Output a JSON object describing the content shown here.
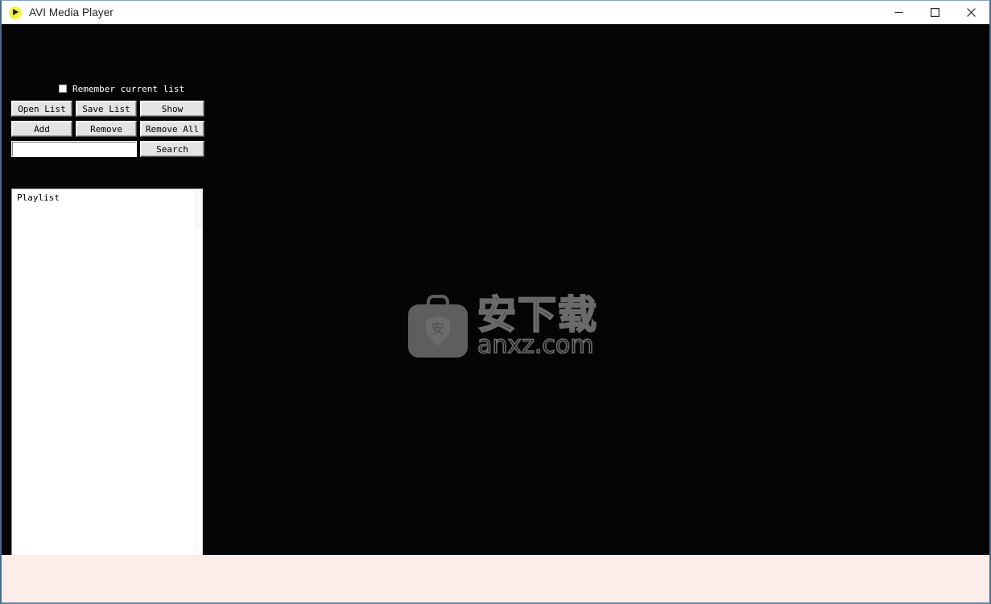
{
  "window": {
    "title": "AVI Media Player",
    "app_icon": "play-circle-icon",
    "controls": {
      "minimize": "minimize-icon",
      "maximize": "maximize-icon",
      "close": "close-icon"
    }
  },
  "controls_panel": {
    "remember_checkbox": {
      "label": "Remember current list",
      "checked": false
    },
    "buttons_row1": [
      {
        "label": "Open List",
        "name": "open-list-button"
      },
      {
        "label": "Save List",
        "name": "save-list-button"
      },
      {
        "label": "Show",
        "name": "show-button"
      }
    ],
    "buttons_row2": [
      {
        "label": "Add",
        "name": "add-button"
      },
      {
        "label": "Remove",
        "name": "remove-button"
      },
      {
        "label": "Remove All",
        "name": "remove-all-button"
      }
    ],
    "search": {
      "value": "",
      "placeholder": "",
      "button_label": "Search"
    }
  },
  "playlist": {
    "items": [
      "Playlist"
    ]
  },
  "watermark": {
    "shield_char": "安",
    "chinese_text": "安下载",
    "domain_text": "anxz.com"
  },
  "colors": {
    "window_background": "#050505",
    "titlebar_background": "#ffffff",
    "button_face": "#e3e3e3",
    "playlist_background": "#ffffff",
    "bottom_strip": "#fcecea",
    "app_icon_accent": "#f2f24a",
    "window_border": "#4a6b8a"
  }
}
